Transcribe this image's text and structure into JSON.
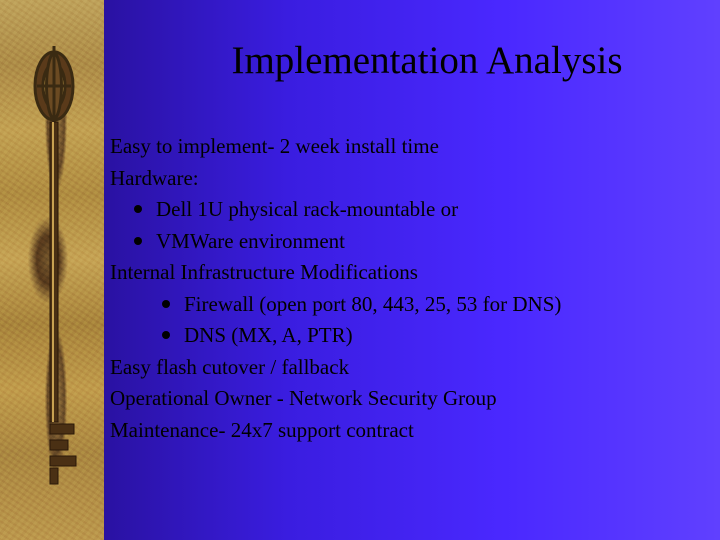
{
  "title": "Implementation Analysis",
  "lines": {
    "l1": "Easy to implement- 2 week install time",
    "l2": "Hardware:",
    "b1": "Dell 1U physical rack-mountable or",
    "b2": "VMWare environment",
    "l3": "Internal Infrastructure Modifications",
    "b3": "Firewall (open port 80, 443, 25, 53 for DNS)",
    "b4": "DNS (MX, A, PTR)",
    "l4": "Easy flash cutover / fallback",
    "l5": "Operational Owner - Network Security Group",
    "l6": "Maintenance- 24x7 support contract"
  }
}
